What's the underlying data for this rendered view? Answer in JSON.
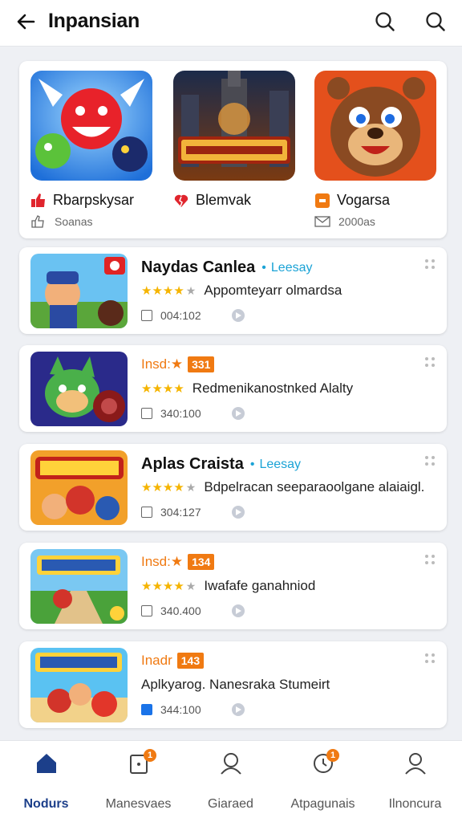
{
  "header": {
    "title": "Inpansian"
  },
  "featured": [
    {
      "name": "Rbarpskysar",
      "sub": "Soanas"
    },
    {
      "name": "Blemvak",
      "sub": ""
    },
    {
      "name": "Vogarsa",
      "sub": "2000as"
    }
  ],
  "list": [
    {
      "name": "Naydas Canlea",
      "tag": "Leesay",
      "rating_text": "Appomteyarr olmardsa",
      "size": "004:102",
      "stars": 4
    },
    {
      "ins": "Insd:",
      "badge": "331",
      "rating_text": "Redmenikanostnked Alalty",
      "size": "340:100",
      "stars": 4
    },
    {
      "name": "Aplas Craista",
      "tag": "Leesay",
      "rating_text": "Bdpelracan seeparaoolgane alaiaigl.",
      "size": "304:127",
      "stars": 4
    },
    {
      "ins": "Insd:",
      "badge": "134",
      "rating_text": "Iwafafe ganahniod",
      "size": "340.400",
      "stars": 4
    },
    {
      "ins": "Inadr",
      "badge": "143",
      "rating_text": "Aplkyarog. Nanesraka Stumeirt",
      "size": "344:100",
      "stars": 0
    }
  ],
  "nav": [
    {
      "label": "Nodurs",
      "active": true,
      "badge": ""
    },
    {
      "label": "Manesvaes",
      "active": false,
      "badge": "1"
    },
    {
      "label": "Giaraed",
      "active": false,
      "badge": ""
    },
    {
      "label": "Atpagunais",
      "active": false,
      "badge": "1"
    },
    {
      "label": "Ilnoncura",
      "active": false,
      "badge": ""
    }
  ],
  "colors": {
    "accent": "#1c3f8a",
    "orange": "#f07a12",
    "tag": "#1ba3d6",
    "star": "#f5b400"
  }
}
